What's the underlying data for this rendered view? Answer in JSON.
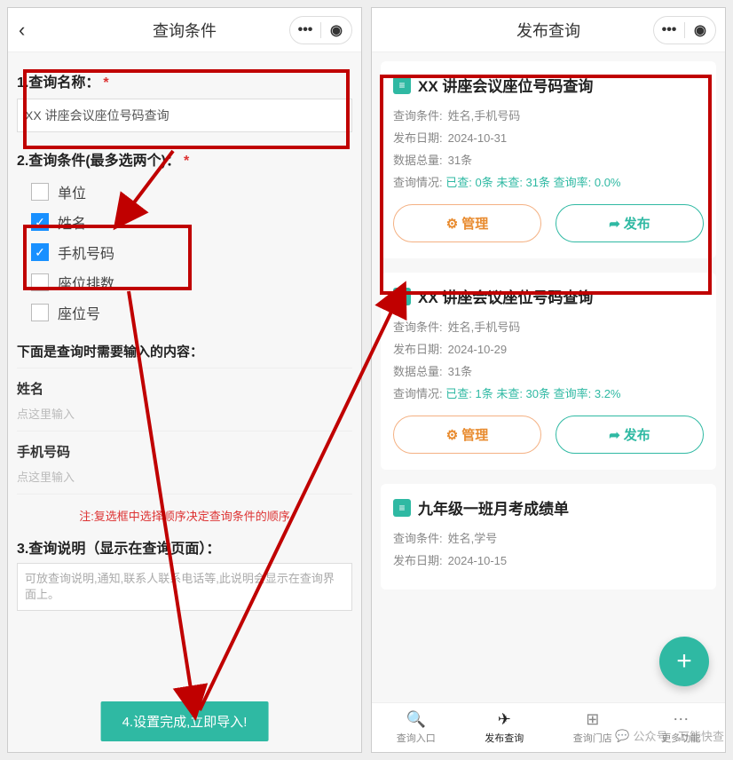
{
  "left": {
    "title": "查询条件",
    "section1_label": "1.查询名称：",
    "query_name": "XX 讲座会议座位号码查询",
    "section2_label": "2.查询条件(最多选两个)：",
    "checkboxes": [
      {
        "label": "单位",
        "checked": false
      },
      {
        "label": "姓名",
        "checked": true
      },
      {
        "label": "手机号码",
        "checked": true
      },
      {
        "label": "座位排数",
        "checked": false
      },
      {
        "label": "座位号",
        "checked": false
      }
    ],
    "input_heading": "下面是查询时需要输入的内容：",
    "fields": [
      {
        "label": "姓名",
        "placeholder": "点这里输入"
      },
      {
        "label": "手机号码",
        "placeholder": "点这里输入"
      }
    ],
    "note": "注:复选框中选择顺序决定查询条件的顺序",
    "section3_label": "3.查询说明（显示在查询页面）：",
    "desc_placeholder": "可放查询说明,通知,联系人联系电话等,此说明会显示在查询界面上。",
    "import_button": "4.设置完成,立即导入!"
  },
  "right": {
    "title": "发布查询",
    "labels": {
      "cond": "查询条件:",
      "date": "发布日期:",
      "total": "数据总量:",
      "stats": "查询情况:",
      "checked": "已查:",
      "unchecked": "未查:",
      "rate": "查询率:"
    },
    "cards": [
      {
        "title": "XX 讲座会议座位号码查询",
        "cond": "姓名,手机号码",
        "date": "2024-10-31",
        "total": "31条",
        "checked": "0条",
        "unchecked": "31条",
        "rate": "0.0%"
      },
      {
        "title": "XX 讲座会议座位号码查询",
        "cond": "姓名,手机号码",
        "date": "2024-10-29",
        "total": "31条",
        "checked": "1条",
        "unchecked": "30条",
        "rate": "3.2%"
      },
      {
        "title": "九年级一班月考成绩单",
        "cond": "姓名,学号",
        "date": "2024-10-15",
        "total": "",
        "checked": "",
        "unchecked": "",
        "rate": ""
      }
    ],
    "buttons": {
      "manage": "管理",
      "publish": "发布"
    },
    "tabs": [
      {
        "label": "查询入口",
        "icon": "🔍"
      },
      {
        "label": "发布查询",
        "icon": "✈"
      },
      {
        "label": "查询门店",
        "icon": "⊞"
      },
      {
        "label": "更多功能",
        "icon": "⋯"
      }
    ]
  },
  "watermark": "公众号 · 万能快查",
  "colors": {
    "accent": "#2fb9a3",
    "highlight": "#c00000"
  }
}
